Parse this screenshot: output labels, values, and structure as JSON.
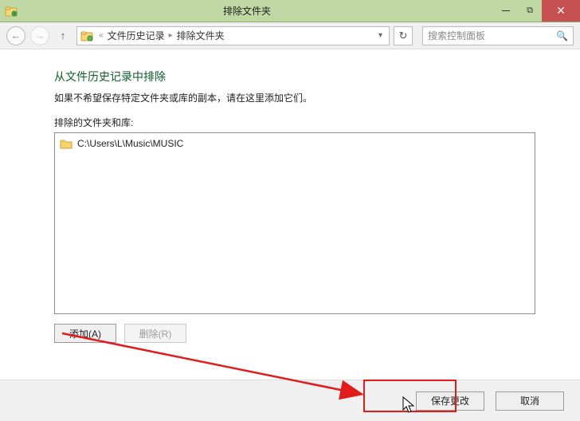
{
  "window": {
    "title": "排除文件夹",
    "controls": {
      "min": "–",
      "max": "⧉",
      "close": "✕"
    }
  },
  "nav": {
    "back": "←",
    "forward": "→",
    "up": "↑",
    "breadcrumb": {
      "sep_left": "«",
      "seg1": "文件历史记录",
      "seg2": "排除文件夹",
      "sep_arrow": "▸",
      "more": "▾"
    },
    "refresh": "↻",
    "search_placeholder": "搜索控制面板",
    "search_icon": "🔍"
  },
  "content": {
    "heading": "从文件历史记录中排除",
    "subtext": "如果不希望保存特定文件夹或库的副本，请在这里添加它们。",
    "list_label": "排除的文件夹和库:",
    "items": [
      {
        "path": "C:\\Users\\L\\Music\\MUSIC"
      }
    ],
    "buttons": {
      "add": "添加(A)",
      "remove": "删除(R)"
    }
  },
  "footer": {
    "save": "保存更改",
    "cancel": "取消"
  }
}
